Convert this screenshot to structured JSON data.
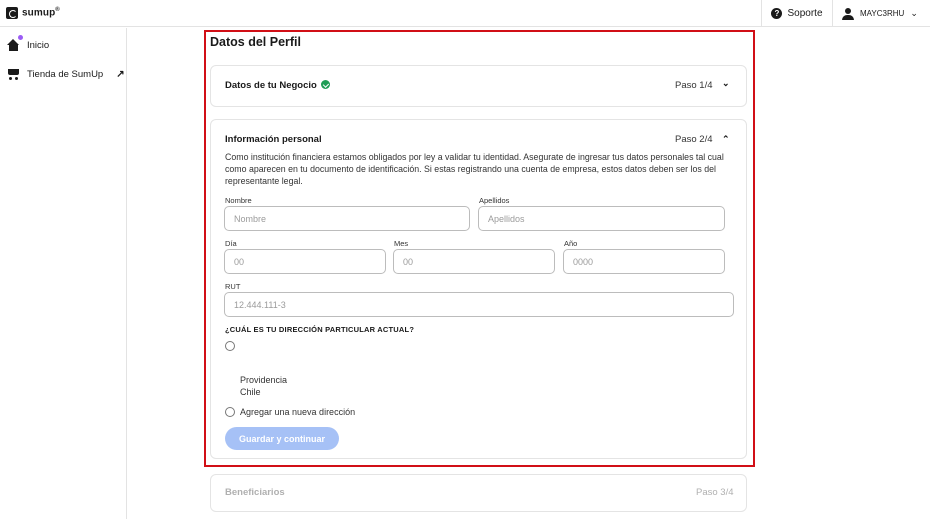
{
  "header": {
    "logo_text": "sumup",
    "logo_reg": "®",
    "support_label": "Soporte",
    "user_name": "MAYC3RHU",
    "icons": [
      "help-icon",
      "user-icon",
      "chevron-down-icon"
    ]
  },
  "sidebar": {
    "items": [
      {
        "label": "Inicio",
        "icon": "home-icon"
      },
      {
        "label": "Tienda de SumUp",
        "icon": "cart-icon"
      }
    ]
  },
  "main": {
    "title": "Datos del Perfil",
    "sections": [
      {
        "title": "Datos de tu Negocio",
        "step": "Paso 1/4",
        "complete": true
      },
      {
        "title": "Información personal",
        "step": "Paso 2/4",
        "complete": false
      },
      {
        "title": "Beneficiarios",
        "step": "Paso 3/4",
        "complete": false
      }
    ],
    "personal": {
      "description": "Como institución financiera estamos obligados por ley a validar tu identidad. Asegurate de ingresar tus datos personales tal cual como aparecen en tu documento de identificación. Si estas registrando una cuenta de empresa, estos datos deben ser los del representante legal.",
      "fields": {
        "nombre": {
          "label": "Nombre",
          "placeholder": "Nombre"
        },
        "apellidos": {
          "label": "Apellidos",
          "placeholder": "Apellidos"
        },
        "dia": {
          "label": "Día",
          "placeholder": "00"
        },
        "mes": {
          "label": "Mes",
          "placeholder": "00"
        },
        "anio": {
          "label": "Año",
          "placeholder": "0000"
        },
        "rut": {
          "label": "RUT",
          "placeholder": "12.444.111-3"
        }
      },
      "address_question": "¿CUÁL ES TU DIRECCIÓN PARTICULAR ACTUAL?",
      "existing_address": {
        "city": "Providencia",
        "country": "Chile"
      },
      "new_address_label": "Agregar una nueva dirección",
      "submit_label": "Guardar y continuar"
    }
  },
  "colors": {
    "highlight_border": "#d10f16",
    "success": "#1f9d55",
    "button_disabled": "#a6c1f6",
    "notification": "#9b5cf5"
  }
}
